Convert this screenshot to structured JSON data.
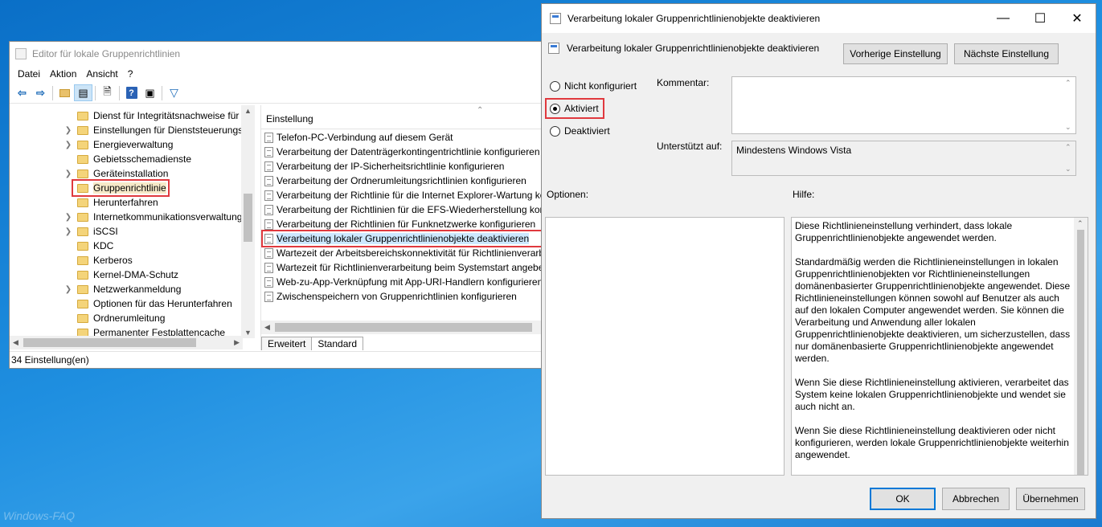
{
  "watermark": "Windows-FAQ",
  "editor": {
    "title": "Editor für lokale Gruppenrichtlinien",
    "menu": [
      "Datei",
      "Aktion",
      "Ansicht",
      "?"
    ],
    "tree_items": [
      {
        "label": "Dienst für Integritätsnachweise für G",
        "expandable": false
      },
      {
        "label": "Einstellungen für Dienststeuerungs-",
        "expandable": true
      },
      {
        "label": "Energieverwaltung",
        "expandable": true
      },
      {
        "label": "Gebietsschemadienste",
        "expandable": false
      },
      {
        "label": "Geräteinstallation",
        "expandable": true
      },
      {
        "label": "Gruppenrichtlinie",
        "expandable": false,
        "selected": true
      },
      {
        "label": "Herunterfahren",
        "expandable": false
      },
      {
        "label": "Internetkommunikationsverwaltung",
        "expandable": true
      },
      {
        "label": "iSCSI",
        "expandable": true
      },
      {
        "label": "KDC",
        "expandable": false
      },
      {
        "label": "Kerberos",
        "expandable": false
      },
      {
        "label": "Kernel-DMA-Schutz",
        "expandable": false
      },
      {
        "label": "Netzwerkanmeldung",
        "expandable": true
      },
      {
        "label": "Optionen für das Herunterfahren",
        "expandable": false
      },
      {
        "label": "Ordnerumleitung",
        "expandable": false
      },
      {
        "label": "Permanenter Festplattencache",
        "expandable": false
      }
    ],
    "list_header": "Einstellung",
    "list_items": [
      {
        "label": "Telefon-PC-Verbindung auf diesem Gerät"
      },
      {
        "label": "Verarbeitung der Datenträgerkontingentrichtlinie konfigurieren"
      },
      {
        "label": "Verarbeitung der IP-Sicherheitsrichtlinie konfigurieren"
      },
      {
        "label": "Verarbeitung der Ordnerumleitungsrichtlinien konfigurieren"
      },
      {
        "label": "Verarbeitung der Richtlinie für die Internet Explorer-Wartung konfigurieren"
      },
      {
        "label": "Verarbeitung der Richtlinien für die EFS-Wiederherstellung konfigurieren"
      },
      {
        "label": "Verarbeitung der Richtlinien für Funknetzwerke konfigurieren"
      },
      {
        "label": "Verarbeitung lokaler Gruppenrichtlinienobjekte deaktivieren",
        "selected": true
      },
      {
        "label": "Wartezeit der Arbeitsbereichskonnektivität für Richtlinienverarbeitung"
      },
      {
        "label": "Wartezeit für Richtlinienverarbeitung beim Systemstart angeben"
      },
      {
        "label": "Web-zu-App-Verknüpfung mit App-URI-Handlern konfigurieren"
      },
      {
        "label": "Zwischenspeichern von Gruppenrichtlinien konfigurieren"
      }
    ],
    "tabs": [
      "Erweitert",
      "Standard"
    ],
    "status": "34 Einstellung(en)"
  },
  "dialog": {
    "title": "Verarbeitung lokaler Gruppenrichtlinienobjekte deaktivieren",
    "subtitle": "Verarbeitung lokaler Gruppenrichtlinienobjekte deaktivieren",
    "prev_button": "Vorherige Einstellung",
    "next_button": "Nächste Einstellung",
    "radio_options": [
      "Nicht konfiguriert",
      "Aktiviert",
      "Deaktiviert"
    ],
    "selected_option": "Aktiviert",
    "comment_label": "Kommentar:",
    "supported_label": "Unterstützt auf:",
    "supported_value": "Mindestens Windows Vista",
    "options_label": "Optionen:",
    "help_label": "Hilfe:",
    "help_paragraphs": [
      "Diese Richtlinieneinstellung verhindert, dass lokale Gruppenrichtlinienobjekte angewendet werden.",
      "Standardmäßig werden die Richtlinieneinstellungen in lokalen Gruppenrichtlinienobjekten vor Richtlinieneinstellungen domänenbasierter Gruppenrichtlinienobjekte angewendet. Diese Richtlinieneinstellungen können sowohl auf Benutzer als auch auf den lokalen Computer angewendet werden. Sie können die Verarbeitung und Anwendung aller lokalen Gruppenrichtlinienobjekte deaktivieren, um sicherzustellen, dass nur domänenbasierte Gruppenrichtlinienobjekte angewendet werden.",
      "Wenn Sie diese Richtlinieneinstellung aktivieren, verarbeitet das System keine lokalen Gruppenrichtlinienobjekte und wendet sie auch nicht an.",
      "Wenn Sie diese Richtlinieneinstellung deaktivieren oder nicht konfigurieren, werden lokale Gruppenrichtlinienobjekte weiterhin angewendet."
    ],
    "ok_button": "OK",
    "cancel_button": "Abbrechen",
    "apply_button": "Übernehmen"
  },
  "colors": {
    "highlight_red": "#e0393e",
    "desktop_blue": "#1f8fe0",
    "selection_blue": "#cde8ff"
  }
}
